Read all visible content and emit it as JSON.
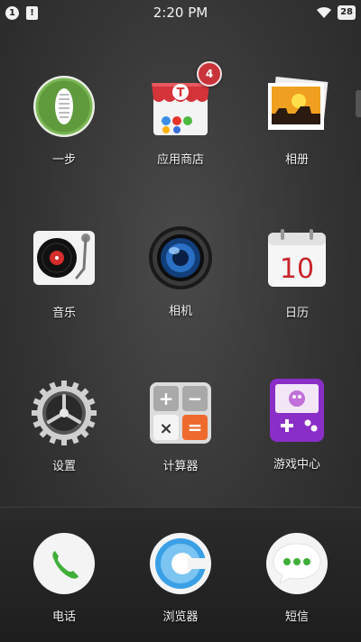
{
  "status_bar": {
    "notification_count": "1",
    "notification_doc": "!",
    "time": "2:20 PM",
    "battery": "28"
  },
  "apps": [
    {
      "label": "一步",
      "icon": "yibu-shoe-icon"
    },
    {
      "label": "应用商店",
      "icon": "app-store-icon",
      "badge": "4",
      "store_letter": "T"
    },
    {
      "label": "相册",
      "icon": "photo-album-icon"
    },
    {
      "label": "音乐",
      "icon": "music-turntable-icon"
    },
    {
      "label": "相机",
      "icon": "camera-lens-icon"
    },
    {
      "label": "日历",
      "icon": "calendar-icon",
      "day": "10"
    },
    {
      "label": "设置",
      "icon": "settings-gear-icon"
    },
    {
      "label": "计算器",
      "icon": "calculator-icon",
      "keys": [
        "+",
        "−",
        "×",
        "="
      ]
    },
    {
      "label": "游戏中心",
      "icon": "game-center-icon"
    }
  ],
  "dock": [
    {
      "label": "电话",
      "icon": "phone-icon"
    },
    {
      "label": "浏览器",
      "icon": "browser-icon"
    },
    {
      "label": "短信",
      "icon": "sms-icon"
    }
  ],
  "colors": {
    "badge": "#c9333a",
    "phone_green": "#3fae3a",
    "calc_orange": "#ee6a2c",
    "game_purple": "#8a2ec8",
    "browser_blue": "#3aa0e6"
  }
}
